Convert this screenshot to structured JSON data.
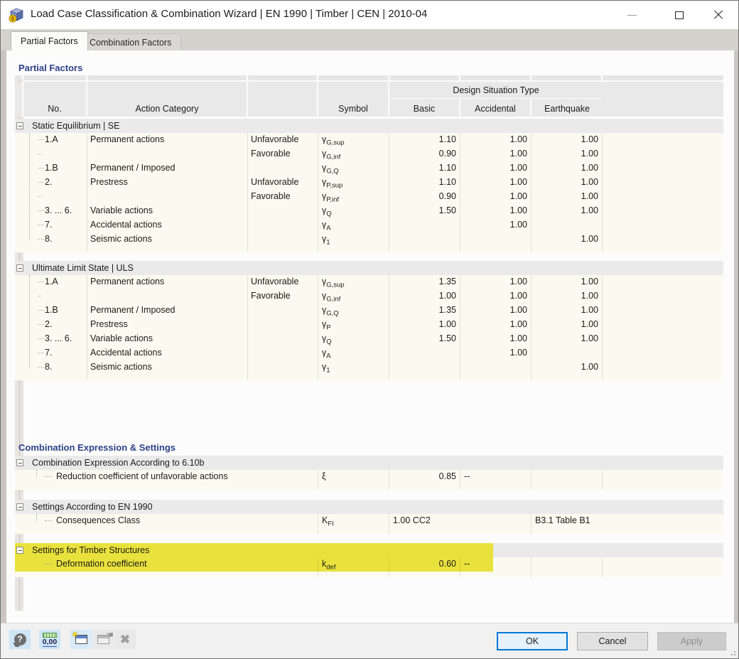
{
  "window": {
    "title": "Load Case Classification & Combination Wizard | EN 1990 | Timber | CEN | 2010-04"
  },
  "tabs": [
    {
      "label": "Partial Factors",
      "active": true
    },
    {
      "label": "Combination Factors",
      "active": false
    }
  ],
  "partial_factors": {
    "section_title": "Partial Factors",
    "header": {
      "no": "No.",
      "action_category": "Action Category",
      "symbol": "Symbol",
      "design_situation_type": "Design Situation Type",
      "basic": "Basic",
      "accidental": "Accidental",
      "earthquake": "Earthquake"
    },
    "groups": [
      {
        "title": "Static Equilibrium | SE",
        "rows": [
          {
            "no": "1.A",
            "category": "Permanent actions",
            "favorability": "Unfavorable",
            "symbol_base": "γ",
            "symbol_sub": "G,sup",
            "basic": "1.10",
            "accidental": "1.00",
            "earthquake": "1.00"
          },
          {
            "no": "",
            "category": "",
            "favorability": "Favorable",
            "symbol_base": "γ",
            "symbol_sub": "G,inf",
            "basic": "0.90",
            "accidental": "1.00",
            "earthquake": "1.00"
          },
          {
            "no": "1.B",
            "category": "Permanent / Imposed",
            "favorability": "",
            "symbol_base": "γ",
            "symbol_sub": "G,Q",
            "basic": "1.10",
            "accidental": "1.00",
            "earthquake": "1.00"
          },
          {
            "no": "2.",
            "category": "Prestress",
            "favorability": "Unfavorable",
            "symbol_base": "γ",
            "symbol_sub": "P,sup",
            "basic": "1.10",
            "accidental": "1.00",
            "earthquake": "1.00"
          },
          {
            "no": "",
            "category": "",
            "favorability": "Favorable",
            "symbol_base": "γ",
            "symbol_sub": "P,inf",
            "basic": "0.90",
            "accidental": "1.00",
            "earthquake": "1.00"
          },
          {
            "no": "3. ... 6.",
            "category": "Variable actions",
            "favorability": "",
            "symbol_base": "γ",
            "symbol_sub": "Q",
            "basic": "1.50",
            "accidental": "1.00",
            "earthquake": "1.00"
          },
          {
            "no": "7.",
            "category": "Accidental actions",
            "favorability": "",
            "symbol_base": "γ",
            "symbol_sub": "A",
            "basic": "",
            "accidental": "1.00",
            "earthquake": ""
          },
          {
            "no": "8.",
            "category": "Seismic actions",
            "favorability": "",
            "symbol_base": "γ",
            "symbol_sub": "1",
            "basic": "",
            "accidental": "",
            "earthquake": "1.00"
          }
        ]
      },
      {
        "title": "Ultimate Limit State | ULS",
        "rows": [
          {
            "no": "1.A",
            "category": "Permanent actions",
            "favorability": "Unfavorable",
            "symbol_base": "γ",
            "symbol_sub": "G,sup",
            "basic": "1.35",
            "accidental": "1.00",
            "earthquake": "1.00"
          },
          {
            "no": "",
            "category": "",
            "favorability": "Favorable",
            "symbol_base": "γ",
            "symbol_sub": "G,inf",
            "basic": "1.00",
            "accidental": "1.00",
            "earthquake": "1.00"
          },
          {
            "no": "1.B",
            "category": "Permanent / Imposed",
            "favorability": "",
            "symbol_base": "γ",
            "symbol_sub": "G,Q",
            "basic": "1.35",
            "accidental": "1.00",
            "earthquake": "1.00"
          },
          {
            "no": "2.",
            "category": "Prestress",
            "favorability": "",
            "symbol_base": "γ",
            "symbol_sub": "P",
            "basic": "1.00",
            "accidental": "1.00",
            "earthquake": "1.00"
          },
          {
            "no": "3. ... 6.",
            "category": "Variable actions",
            "favorability": "",
            "symbol_base": "γ",
            "symbol_sub": "Q",
            "basic": "1.50",
            "accidental": "1.00",
            "earthquake": "1.00"
          },
          {
            "no": "7.",
            "category": "Accidental actions",
            "favorability": "",
            "symbol_base": "γ",
            "symbol_sub": "A",
            "basic": "",
            "accidental": "1.00",
            "earthquake": ""
          },
          {
            "no": "8.",
            "category": "Seismic actions",
            "favorability": "",
            "symbol_base": "γ",
            "symbol_sub": "1",
            "basic": "",
            "accidental": "",
            "earthquake": "1.00"
          }
        ]
      }
    ]
  },
  "combination": {
    "section_title": "Combination Expression & Settings",
    "groups": [
      {
        "title": "Combination Expression According to 6.10b",
        "highlight": false,
        "rows": [
          {
            "label": "Reduction coefficient of unfavorable actions",
            "symbol_base": "ξ",
            "symbol_sub": "",
            "value": "0.85",
            "wide_value": false,
            "note": "--"
          }
        ]
      },
      {
        "title": "Settings According to EN 1990",
        "highlight": false,
        "rows": [
          {
            "label": "Consequences Class",
            "symbol_base": "K",
            "symbol_sub": "FI",
            "value": "1.00 CC2",
            "wide_value": true,
            "note": "B3.1 Table B1"
          }
        ]
      },
      {
        "title": "Settings for Timber Structures",
        "highlight": true,
        "rows": [
          {
            "label": "Deformation coefficient",
            "symbol_base": "k",
            "symbol_sub": "def",
            "value": "0.60",
            "wide_value": false,
            "note": "--"
          }
        ]
      }
    ]
  },
  "toolbar": {
    "units_label": "0,00",
    "icons": [
      "help-icon",
      "units-decimal-places-icon",
      "new-window-star-icon",
      "import-hand-window-icon",
      "delete-x-icon"
    ]
  },
  "buttons": {
    "ok": "OK",
    "cancel": "Cancel",
    "apply": "Apply"
  },
  "colors": {
    "section_title": "#2e4188",
    "highlight_yellow": "#e9e23c",
    "row_cream": "#fbfaf0",
    "group_gray": "#eaeaea",
    "focus_blue": "#0078d7"
  }
}
